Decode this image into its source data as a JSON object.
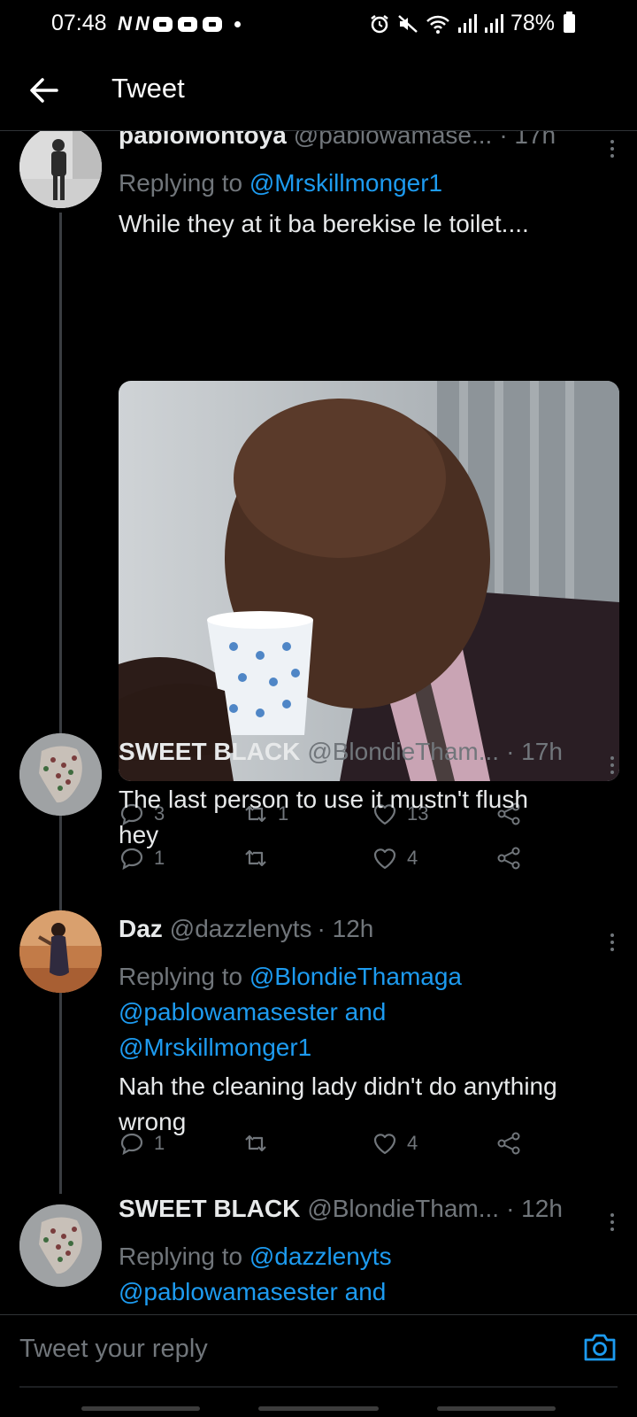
{
  "status_bar": {
    "time": "07:48",
    "notification_letters": [
      "N",
      "N"
    ],
    "battery": "78%"
  },
  "header": {
    "title": "Tweet"
  },
  "tweets": [
    {
      "name": "pabloMontoya",
      "handle": "@pablowamase...",
      "time": "· 17h",
      "replying_prefix": "Replying to",
      "replying_mentions": "@Mrskillmonger1",
      "text": "While they at it ba berekise le toilet....",
      "media_alt": "man drinking from polka dot mug",
      "replies": "3",
      "retweets": "1",
      "likes": "13"
    },
    {
      "name": "SWEET BLACK",
      "handle": "@BlondieTham...",
      "time": "· 17h",
      "text_line1": "The last person to use it mustn't flush",
      "text_line2": "hey",
      "replies": "1",
      "retweets": "",
      "likes": "4"
    },
    {
      "name": "Daz",
      "handle": "@dazzlenyts",
      "time": "· 12h",
      "replying_prefix": "Replying to",
      "replying_line1": "@BlondieThamaga",
      "replying_line2": "@pablowamasester and",
      "replying_line3": "@Mrskillmonger1",
      "text_line1": "Nah the cleaning lady didn't do anything",
      "text_line2": "wrong",
      "replies": "1",
      "retweets": "",
      "likes": "4"
    },
    {
      "name": "SWEET BLACK",
      "handle": "@BlondieTham...",
      "time": "· 12h",
      "replying_prefix": "Replying to",
      "replying_line1": "@dazzlenyts",
      "replying_line2": "@pablowamasester and"
    }
  ],
  "composer": {
    "placeholder": "Tweet your reply"
  },
  "colors": {
    "background": "#000000",
    "accent": "#1d9bf0",
    "muted": "#71767b",
    "text": "#e7e9ea"
  },
  "icons": [
    "back-arrow-icon",
    "reply-icon",
    "retweet-icon",
    "heart-icon",
    "share-icon",
    "more-icon",
    "camera-icon",
    "alarm-icon",
    "mute-icon",
    "wifi-icon",
    "signal-icon",
    "battery-icon"
  ]
}
